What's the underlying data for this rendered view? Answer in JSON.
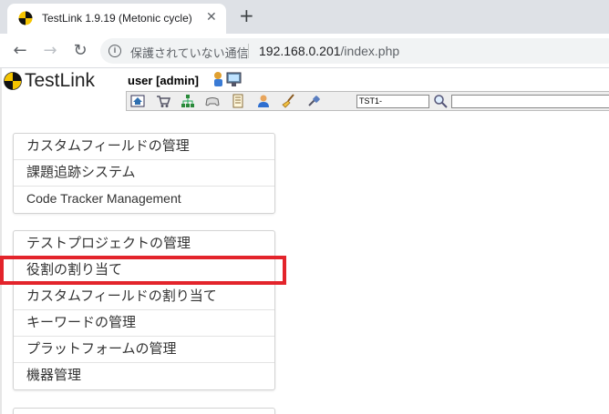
{
  "browser": {
    "tab_title": "TestLink 1.9.19 (Metonic cycle)",
    "tab_close": "✕",
    "new_tab": "+",
    "security_label": "保護されていない通信",
    "url_host": "192.168.0.201",
    "url_path": "/index.php"
  },
  "header": {
    "logo_text": "TestLink",
    "user_label": "user [admin]",
    "testproject_input": "TST1-",
    "search_input_value": ""
  },
  "menus": {
    "group1": [
      {
        "label": "カスタムフィールドの管理"
      },
      {
        "label": "課題追跡システム"
      },
      {
        "label": "Code Tracker Management"
      }
    ],
    "group2": [
      {
        "label": "テストプロジェクトの管理"
      },
      {
        "label": "役割の割り当て"
      },
      {
        "label": "カスタムフィールドの割り当て"
      },
      {
        "label": "キーワードの管理"
      },
      {
        "label": "プラットフォームの管理"
      },
      {
        "label": "機器管理"
      }
    ]
  },
  "colors": {
    "highlight": "#e3242b",
    "tab_strip": "#dee1e6"
  }
}
